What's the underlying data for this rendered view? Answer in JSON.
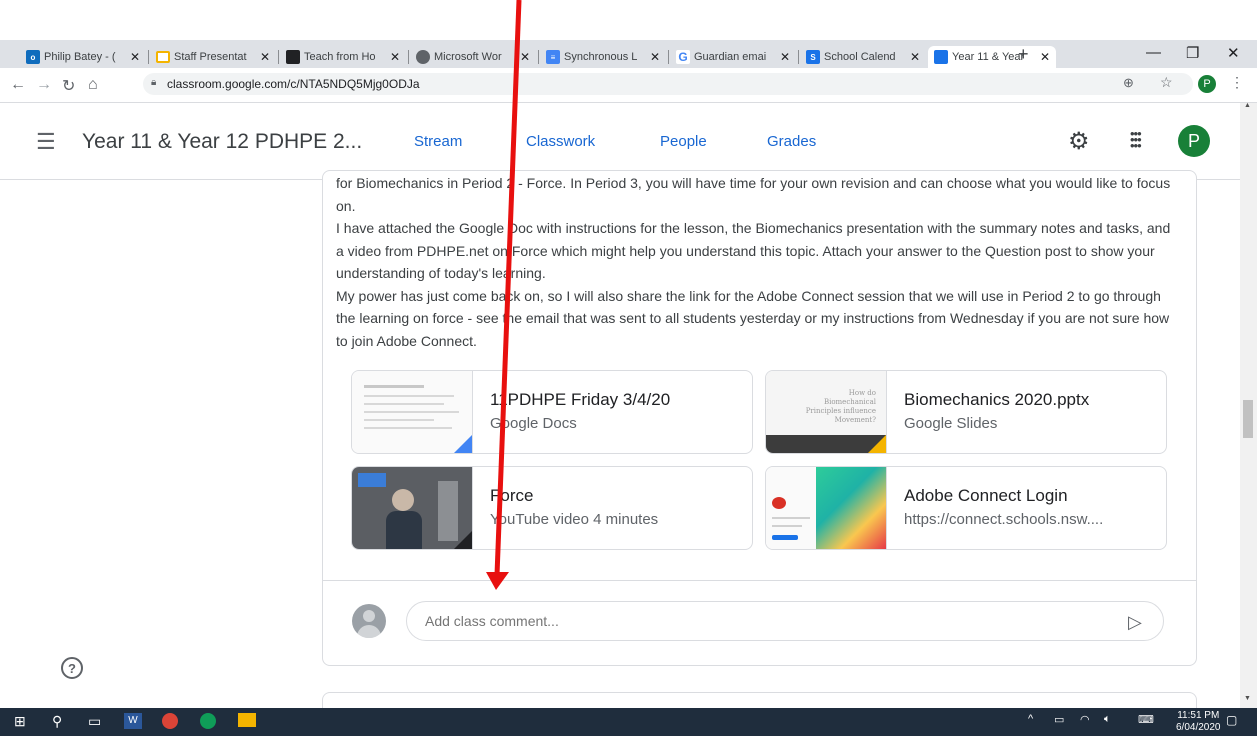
{
  "browser": {
    "tabs": [
      {
        "title": "Philip Batey - (",
        "icon": "outlook-icon",
        "color": "#0f6cbd",
        "glyph": "o"
      },
      {
        "title": "Staff Presentat",
        "icon": "slides-icon",
        "color": "#f4b400",
        "glyph": ""
      },
      {
        "title": "Teach from Ho",
        "icon": "classroom-dark-icon",
        "color": "#202124",
        "glyph": ""
      },
      {
        "title": "Microsoft Wor",
        "icon": "globe-icon",
        "color": "#5f6368",
        "glyph": ""
      },
      {
        "title": "Synchronous L",
        "icon": "docs-icon",
        "color": "#4285f4",
        "glyph": ""
      },
      {
        "title": "Guardian emai",
        "icon": "google-icon",
        "color": "#ffffff",
        "glyph": "G"
      },
      {
        "title": "School Calend",
        "icon": "sway-icon",
        "color": "#1a73e8",
        "glyph": ""
      },
      {
        "title": "Year 11 & Year",
        "icon": "classroom-icon",
        "color": "#1a73e8",
        "glyph": ""
      }
    ],
    "new_tab": "+",
    "url": "classroom.google.com/c/NTA5NDQ5Mjg0ODJa",
    "profile_letter": "P"
  },
  "header": {
    "class_title": "Year 11 & Year 12 PDHPE 2...",
    "tabs": [
      "Stream",
      "Classwork",
      "People",
      "Grades"
    ],
    "active_tab": "Stream",
    "avatar_letter": "P"
  },
  "post": {
    "paragraphs": [
      "for Biomechanics in Period 2 - Force. In Period 3, you will have time for your own revision and can choose what you would like to focus on.",
      "I have attached the Google Doc with instructions for the lesson, the Biomechanics presentation with the summary notes and tasks, and a video from PDHPE.net on Force which might help you understand this topic. Attach your answer to the Question post to show your understanding of today's learning.",
      "My power has just come back on, so I will also share the link for the Adobe Connect session that we will use in Period 2 to go through the learning on force - see the email that was sent to all students yesterday or my instructions from Wednesday if you are not sure how to join Adobe Connect."
    ],
    "attachments": [
      {
        "title": "11PDHPE Friday 3/4/20",
        "subtitle": "Google Docs"
      },
      {
        "title": "Biomechanics 2020.pptx",
        "subtitle": "Google Slides",
        "thumb_text": "How do Biomechanical Principles influence Movement?"
      },
      {
        "title": "Force",
        "subtitle": "YouTube video   4 minutes"
      },
      {
        "title": "Adobe Connect Login",
        "subtitle": "https://connect.schools.nsw...."
      }
    ],
    "comment_placeholder": "Add class comment..."
  },
  "taskbar": {
    "time": "11:51 PM",
    "date": "6/04/2020"
  },
  "colors": {
    "accent": "#1967d2",
    "avatar": "#188038",
    "annotation_arrow": "#e8100f"
  }
}
